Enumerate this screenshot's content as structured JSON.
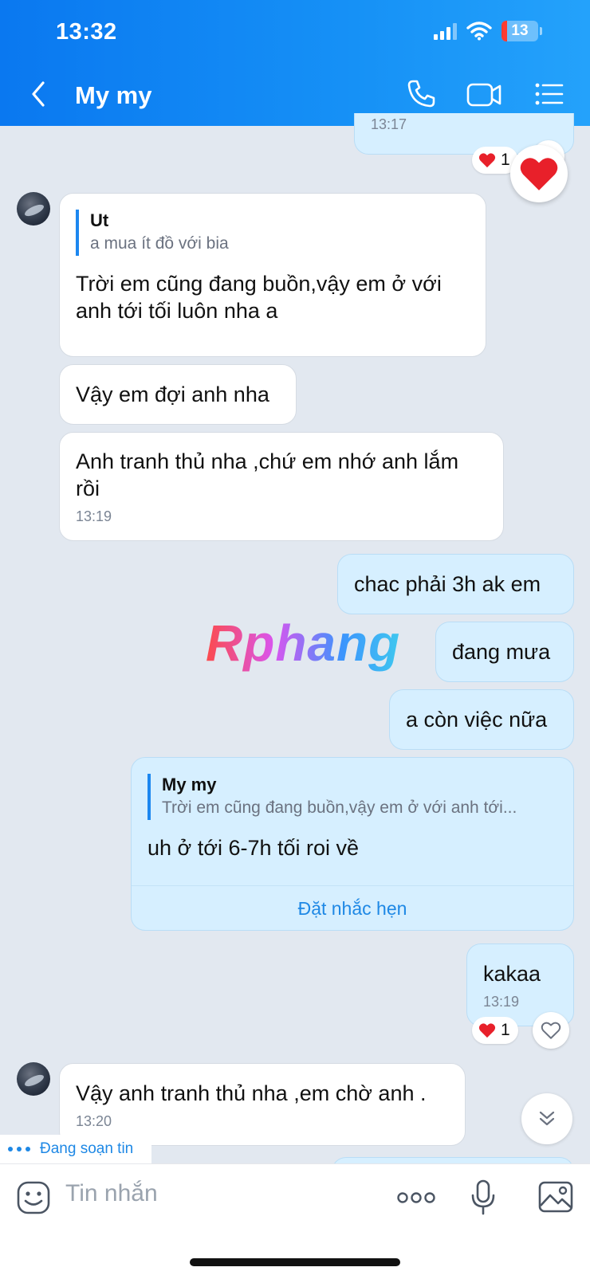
{
  "status_bar": {
    "time": "13:32",
    "battery": "13"
  },
  "header": {
    "title": "My my"
  },
  "top_partial": {
    "time": "13:17",
    "reaction_count": "1"
  },
  "messages": [
    {
      "quote": {
        "author": "Ut",
        "text": "a mua ít đồ với bia"
      },
      "text": "Trời em cũng đang buồn,vậy em ở với anh tới tối luôn nha a"
    },
    {
      "text": "Vậy em đợi anh nha"
    },
    {
      "text": "Anh tranh thủ nha ,chứ em nhớ anh lắm rồi",
      "time": "13:19"
    },
    {
      "text": "chac phải 3h ak em"
    },
    {
      "text": "đang mưa"
    },
    {
      "text": "a còn việc nữa"
    },
    {
      "quote": {
        "author": "My my",
        "text": "Trời em cũng đang buồn,vậy em ở với anh tới..."
      },
      "text": "uh ở tới 6-7h tối roi về",
      "action": "Đặt nhắc hẹn"
    },
    {
      "text": "kakaa",
      "time": "13:19",
      "reaction_count": "1"
    },
    {
      "text": "Vậy anh tranh thủ nha ,em chờ anh .",
      "time": "13:20"
    }
  ],
  "watermark": "Rphang",
  "typing": "Đang soạn tin",
  "composer": {
    "placeholder": "Tin nhắn"
  }
}
